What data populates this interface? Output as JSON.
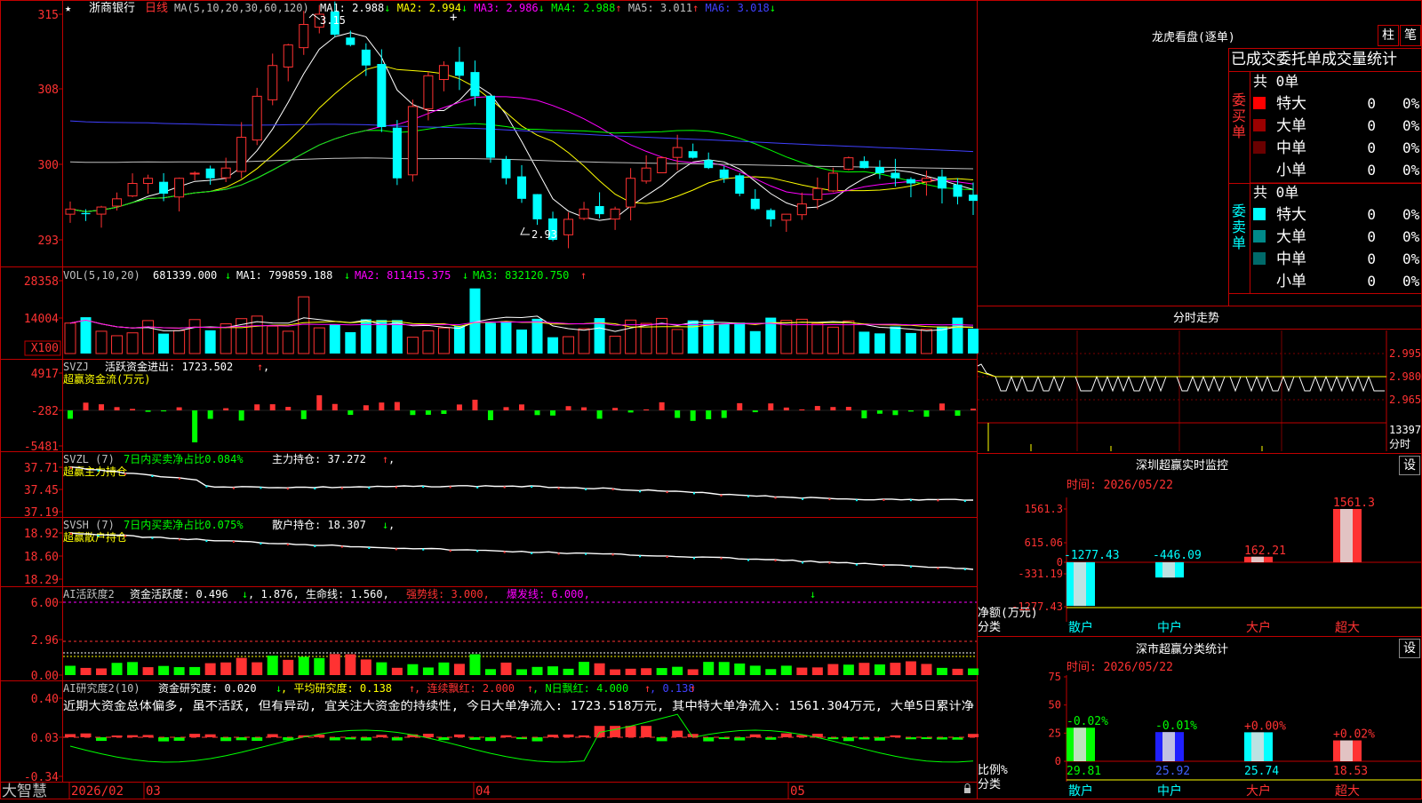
{
  "colors": {
    "up": "#ff3232",
    "down": "#00ffff",
    "bg": "#000000",
    "frame": "#c00000",
    "green": "#00ff00"
  },
  "app": {
    "brand": "大智慧"
  },
  "main": {
    "star": "★",
    "title": "浙商银行",
    "period": "日线",
    "ma_header": "MA(5,10,20,30,60,120)",
    "mas": [
      {
        "label": "MA1: 2.988",
        "arrow": "↓",
        "color": "#ffffff"
      },
      {
        "label": "MA2: 2.994",
        "arrow": "↓",
        "color": "#ffff00"
      },
      {
        "label": "MA3: 2.986",
        "arrow": "↓",
        "color": "#ff00ff"
      },
      {
        "label": "MA4: 2.988",
        "arrow": "↑",
        "color": "#00ff00"
      },
      {
        "label": "MA5: 3.011",
        "arrow": "↑",
        "color": "#c0c0c0"
      },
      {
        "label": "MA6: 3.018",
        "arrow": "↓",
        "color": "#4040ff"
      }
    ],
    "yticks": [
      "315",
      "308",
      "300",
      "293"
    ],
    "high_label": "3.15",
    "low_label": "2.93",
    "cursor_mark": "+"
  },
  "vol": {
    "header": "VOL(5,10,20)",
    "value": "681339.000",
    "arrow": "↓",
    "ma1": "MA1: 799859.188",
    "ma1_arrow": "↓",
    "ma2": "MA2: 811415.375",
    "ma2_arrow": "↓",
    "ma3": "MA3: 832120.750",
    "ma3_arrow": "↑",
    "yticks": [
      "28358",
      "14004"
    ],
    "unit": "X100"
  },
  "svzj": {
    "name": "SVZJ",
    "label": "活跃资金进出: 1723.502",
    "arrow": "↑",
    "tail": ",",
    "subtitle": "超赢资金流(万元)",
    "yticks": [
      "4917",
      "-282",
      "-5481"
    ]
  },
  "svzl": {
    "name": "SVZL (7)",
    "label1": "7日内买卖净占比0.084%",
    "label2": "主力持仓: 37.272",
    "arrow": "↑",
    "tail": ",",
    "subtitle": "超赢主力持仓",
    "yticks": [
      "37.71",
      "37.45",
      "37.19"
    ]
  },
  "svsh": {
    "name": "SVSH (7)",
    "label1": "7日内买卖净占比0.075%",
    "label2": "散户持仓: 18.307",
    "arrow": "↓",
    "tail": ",",
    "subtitle": "超赢散户持仓",
    "yticks": [
      "18.92",
      "18.60",
      "18.29"
    ]
  },
  "ai1": {
    "name": "AI活跃度2",
    "label1": "资金活跃度: 0.496",
    "arrow1": "↓",
    "label2": ", 1.876, 生命线: 1.560,",
    "label3": "强势线: 3.000,",
    "label4": "爆发线: 6.000,",
    "yticks": [
      "6.00",
      "2.96",
      "0.00"
    ],
    "marker": "↓"
  },
  "ai2": {
    "name": "AI研究度2(10)",
    "label1": "资金研究度: 0.020",
    "arrow1": "↓",
    "label2": ", 平均研究度: 0.138",
    "arrow2": "↑",
    "label3": ", 连续飘红: 2.000",
    "arrow3": "↑",
    "label4": ", N日飘红: 4.000",
    "arrow4": "↑",
    "label5": ", 0.138",
    "arrow5": "↑",
    "commentary": "近期大资金总体偏多, 虽不活跃, 但有异动, 宜关注大资金的持续性, 今日大单净流入: 1723.518万元, 其中特大单净流入: 1561.304万元, 大单5日累计净",
    "yticks": [
      "0.40",
      "0.03",
      "-0.34"
    ]
  },
  "xaxis": {
    "labels": [
      "2026/02",
      "03",
      "04",
      "05"
    ]
  },
  "lhb": {
    "title": "龙虎看盘(逐单)",
    "tabs": [
      "柱",
      "笔"
    ],
    "subtitle": "已成交委托单成交量统计",
    "buy": {
      "side_label": "委买单",
      "total": "共 0单",
      "rows": [
        {
          "name": "特大",
          "count": "0",
          "pct": "0%",
          "color": "#ff0000"
        },
        {
          "name": "大单",
          "count": "0",
          "pct": "0%",
          "color": "#9a0000"
        },
        {
          "name": "中单",
          "count": "0",
          "pct": "0%",
          "color": "#6a0000"
        },
        {
          "name": "小单",
          "count": "0",
          "pct": "0%",
          "color": ""
        }
      ]
    },
    "sell": {
      "side_label": "委卖单",
      "total": "共 0单",
      "rows": [
        {
          "name": "特大",
          "count": "0",
          "pct": "0%",
          "color": "#00ffff"
        },
        {
          "name": "大单",
          "count": "0",
          "pct": "0%",
          "color": "#008a8a"
        },
        {
          "name": "中单",
          "count": "0",
          "pct": "0%",
          "color": "#006a6a"
        },
        {
          "name": "小单",
          "count": "0",
          "pct": "0%",
          "color": ""
        }
      ]
    }
  },
  "intraday": {
    "title": "分时走势",
    "yticks": [
      "2.995",
      "2.980",
      "2.965"
    ],
    "vol_value": "13397",
    "vol_label": "分时"
  },
  "monitor": {
    "title": "深圳超赢实时监控",
    "set": "设",
    "date": "时间: 2026/05/22",
    "yticks": [
      "1561.3",
      "615.06",
      "0",
      "-331.19",
      "-1277.43"
    ],
    "axis_label": "净额(万元)",
    "cat_label": "分类",
    "bars": [
      {
        "cat": "散户",
        "value": -1277.43,
        "label": "-1277.43"
      },
      {
        "cat": "中户",
        "value": -446.09,
        "label": "-446.09"
      },
      {
        "cat": "大户",
        "value": 162.21,
        "label": "162.21"
      },
      {
        "cat": "超大",
        "value": 1561.3,
        "label": "1561.3"
      }
    ]
  },
  "classify": {
    "title": "深市超赢分类统计",
    "set": "设",
    "date": "时间: 2026/05/22",
    "yticks": [
      "75",
      "50",
      "25",
      "0"
    ],
    "axis_label": "比例%",
    "cat_label": "分类",
    "bars": [
      {
        "cat": "散户",
        "value": 29.81,
        "label": "29.81",
        "change": "-0.02%"
      },
      {
        "cat": "中户",
        "value": 25.92,
        "label": "25.92",
        "change": "-0.01%"
      },
      {
        "cat": "大户",
        "value": 25.74,
        "label": "25.74",
        "change": "+0.00%"
      },
      {
        "cat": "超大",
        "value": 18.53,
        "label": "18.53",
        "change": "+0.02%"
      }
    ]
  }
}
